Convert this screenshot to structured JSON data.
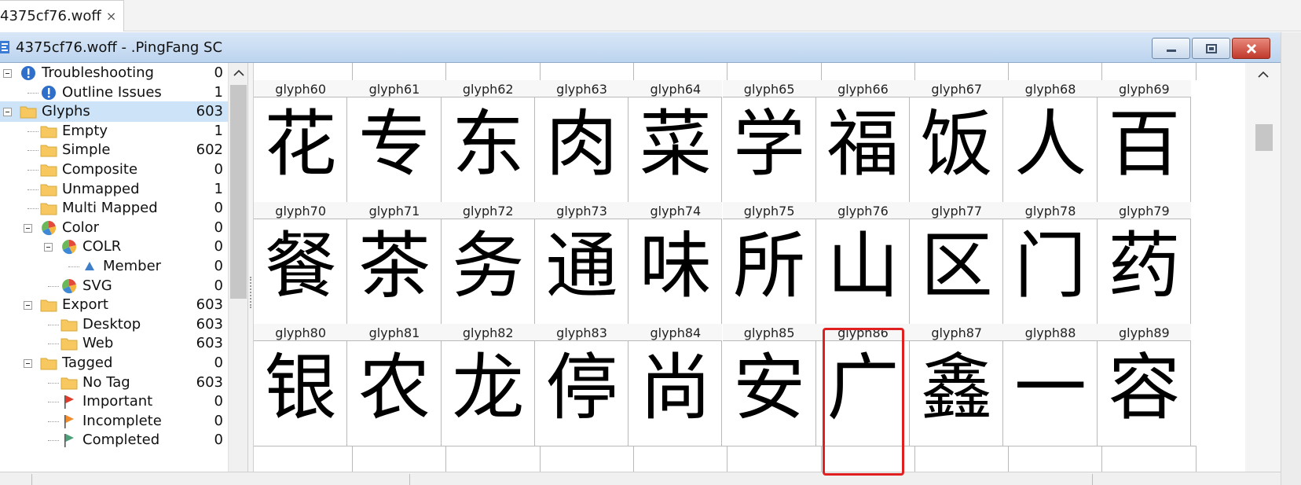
{
  "tab": {
    "title": "4375cf76.woff",
    "close_glyph": "×"
  },
  "window": {
    "title": "4375cf76.woff - .PingFang SC",
    "buttons": [
      {
        "name": "minimize",
        "icon": "minimize-icon"
      },
      {
        "name": "maximize",
        "icon": "maximize-icon"
      },
      {
        "name": "close",
        "icon": "close-icon"
      }
    ]
  },
  "tree": [
    {
      "label": "Troubleshooting",
      "count": "0",
      "icon": "info-icon",
      "expanded": true
    },
    {
      "label": "Outline Issues",
      "count": "1",
      "icon": "info-icon"
    },
    {
      "label": "Glyphs",
      "count": "603",
      "icon": "folder-icon",
      "expanded": true,
      "selected": true
    },
    {
      "label": "Empty",
      "count": "1",
      "icon": "folder-icon"
    },
    {
      "label": "Simple",
      "count": "602",
      "icon": "folder-icon"
    },
    {
      "label": "Composite",
      "count": "0",
      "icon": "folder-icon"
    },
    {
      "label": "Unmapped",
      "count": "1",
      "icon": "folder-icon"
    },
    {
      "label": "Multi Mapped",
      "count": "0",
      "icon": "folder-icon"
    },
    {
      "label": "Color",
      "count": "0",
      "icon": "color-wheel-icon",
      "expanded": true
    },
    {
      "label": "COLR",
      "count": "0",
      "icon": "color-wheel-icon",
      "expanded": true
    },
    {
      "label": "Member",
      "count": "0",
      "icon": "triangle-icon"
    },
    {
      "label": "SVG",
      "count": "0",
      "icon": "color-wheel-icon"
    },
    {
      "label": "Export",
      "count": "603",
      "icon": "folder-icon",
      "expanded": true
    },
    {
      "label": "Desktop",
      "count": "603",
      "icon": "folder-icon"
    },
    {
      "label": "Web",
      "count": "603",
      "icon": "folder-icon"
    },
    {
      "label": "Tagged",
      "count": "0",
      "icon": "folder-icon",
      "expanded": true
    },
    {
      "label": "No Tag",
      "count": "603",
      "icon": "folder-icon"
    },
    {
      "label": "Important",
      "count": "0",
      "icon": "red-flag-icon"
    },
    {
      "label": "Incomplete",
      "count": "0",
      "icon": "orange-flag-icon"
    },
    {
      "label": "Completed",
      "count": "0",
      "icon": "green-flag-icon"
    }
  ],
  "glyph_rows": [
    [
      {
        "name": "glyph60",
        "char": "花"
      },
      {
        "name": "glyph61",
        "char": "专"
      },
      {
        "name": "glyph62",
        "char": "东"
      },
      {
        "name": "glyph63",
        "char": "肉"
      },
      {
        "name": "glyph64",
        "char": "菜"
      },
      {
        "name": "glyph65",
        "char": "学"
      },
      {
        "name": "glyph66",
        "char": "福"
      },
      {
        "name": "glyph67",
        "char": "饭"
      },
      {
        "name": "glyph68",
        "char": "人"
      },
      {
        "name": "glyph69",
        "char": "百"
      }
    ],
    [
      {
        "name": "glyph70",
        "char": "餐"
      },
      {
        "name": "glyph71",
        "char": "茶"
      },
      {
        "name": "glyph72",
        "char": "务"
      },
      {
        "name": "glyph73",
        "char": "通"
      },
      {
        "name": "glyph74",
        "char": "味"
      },
      {
        "name": "glyph75",
        "char": "所"
      },
      {
        "name": "glyph76",
        "char": "山"
      },
      {
        "name": "glyph77",
        "char": "区"
      },
      {
        "name": "glyph78",
        "char": "门"
      },
      {
        "name": "glyph79",
        "char": "药"
      }
    ],
    [
      {
        "name": "glyph80",
        "char": "银"
      },
      {
        "name": "glyph81",
        "char": "农"
      },
      {
        "name": "glyph82",
        "char": "龙"
      },
      {
        "name": "glyph83",
        "char": "停"
      },
      {
        "name": "glyph84",
        "char": "尚"
      },
      {
        "name": "glyph85",
        "char": "安"
      },
      {
        "name": "glyph86",
        "char": "广"
      },
      {
        "name": "glyph87",
        "char": "鑫"
      },
      {
        "name": "glyph88",
        "char": "一"
      },
      {
        "name": "glyph89",
        "char": "容"
      }
    ]
  ],
  "highlighted_glyph": "glyph86",
  "colors": {
    "highlight": "#e02020",
    "selection": "#cde3f7",
    "folder": "#f6c85f"
  }
}
